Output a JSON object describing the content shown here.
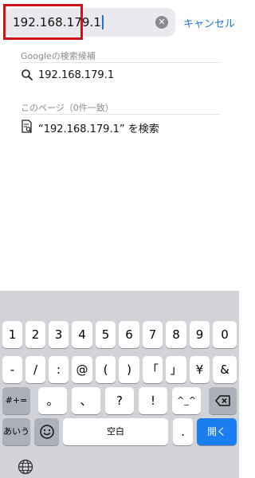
{
  "search": {
    "value": "192.168.179.1",
    "cancel_label": "キャンセル",
    "clear_icon": "clear-icon"
  },
  "suggestions": {
    "google_header": "Googleの検索候補",
    "google_items": [
      {
        "icon": "search-icon",
        "label": "192.168.179.1"
      }
    ],
    "page_header": "このページ（0件一致）",
    "page_items": [
      {
        "icon": "find-in-page-icon",
        "label": "“192.168.179.1” を検索"
      }
    ]
  },
  "keyboard": {
    "row1": [
      "1",
      "2",
      "3",
      "4",
      "5",
      "6",
      "7",
      "8",
      "9",
      "0"
    ],
    "row2": [
      "-",
      "/",
      ":",
      "@",
      "(",
      ")",
      "「",
      "」",
      "¥",
      "&"
    ],
    "row3_mode": "#+=",
    "row3": [
      "。",
      "、",
      "?",
      "!",
      "^_^"
    ],
    "row3_delete_icon": "backspace-icon",
    "row4_lang": "あいう",
    "row4_emoji_icon": "emoji-icon",
    "row4_space": "空白",
    "row4_period": ".",
    "row4_return": "開く",
    "globe_icon": "globe-icon"
  },
  "colors": {
    "accent": "#1a73e8",
    "highlight_border": "#d0121a",
    "return_key": "#1a7ef0"
  }
}
